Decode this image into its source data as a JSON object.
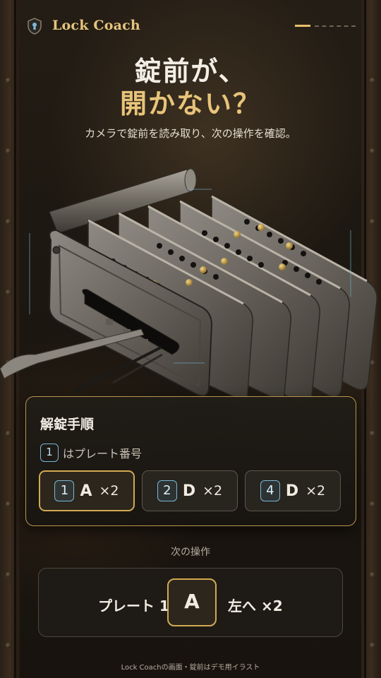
{
  "header": {
    "app_name": "Lock Coach",
    "logo_icon": "keyhole-shield-icon",
    "progress": {
      "current": 1,
      "total": 4
    }
  },
  "hero": {
    "title_line1": "錠前が、",
    "title_line2": "開かない？",
    "subtitle": "カメラで錠前を読み取り、次の操作を確認。"
  },
  "steps": {
    "title": "解錠手順",
    "hint_num": "1",
    "hint_text": "はプレート番号",
    "items": [
      {
        "plate": "1",
        "letter": "A",
        "count": "×2",
        "active": true
      },
      {
        "plate": "2",
        "letter": "D",
        "count": "×2",
        "active": false
      },
      {
        "plate": "4",
        "letter": "D",
        "count": "×2",
        "active": false
      }
    ]
  },
  "next": {
    "label": "次の操作",
    "plate_text": "プレート 1",
    "key": "A",
    "direction": "左へ ×2"
  },
  "footer": {
    "note": "Lock Coachの画面・錠前はデモ用イラスト"
  },
  "colors": {
    "accent_gold": "#e6bf6c",
    "plate_number_blue": "#79b7d6",
    "background": "#1c1711"
  }
}
